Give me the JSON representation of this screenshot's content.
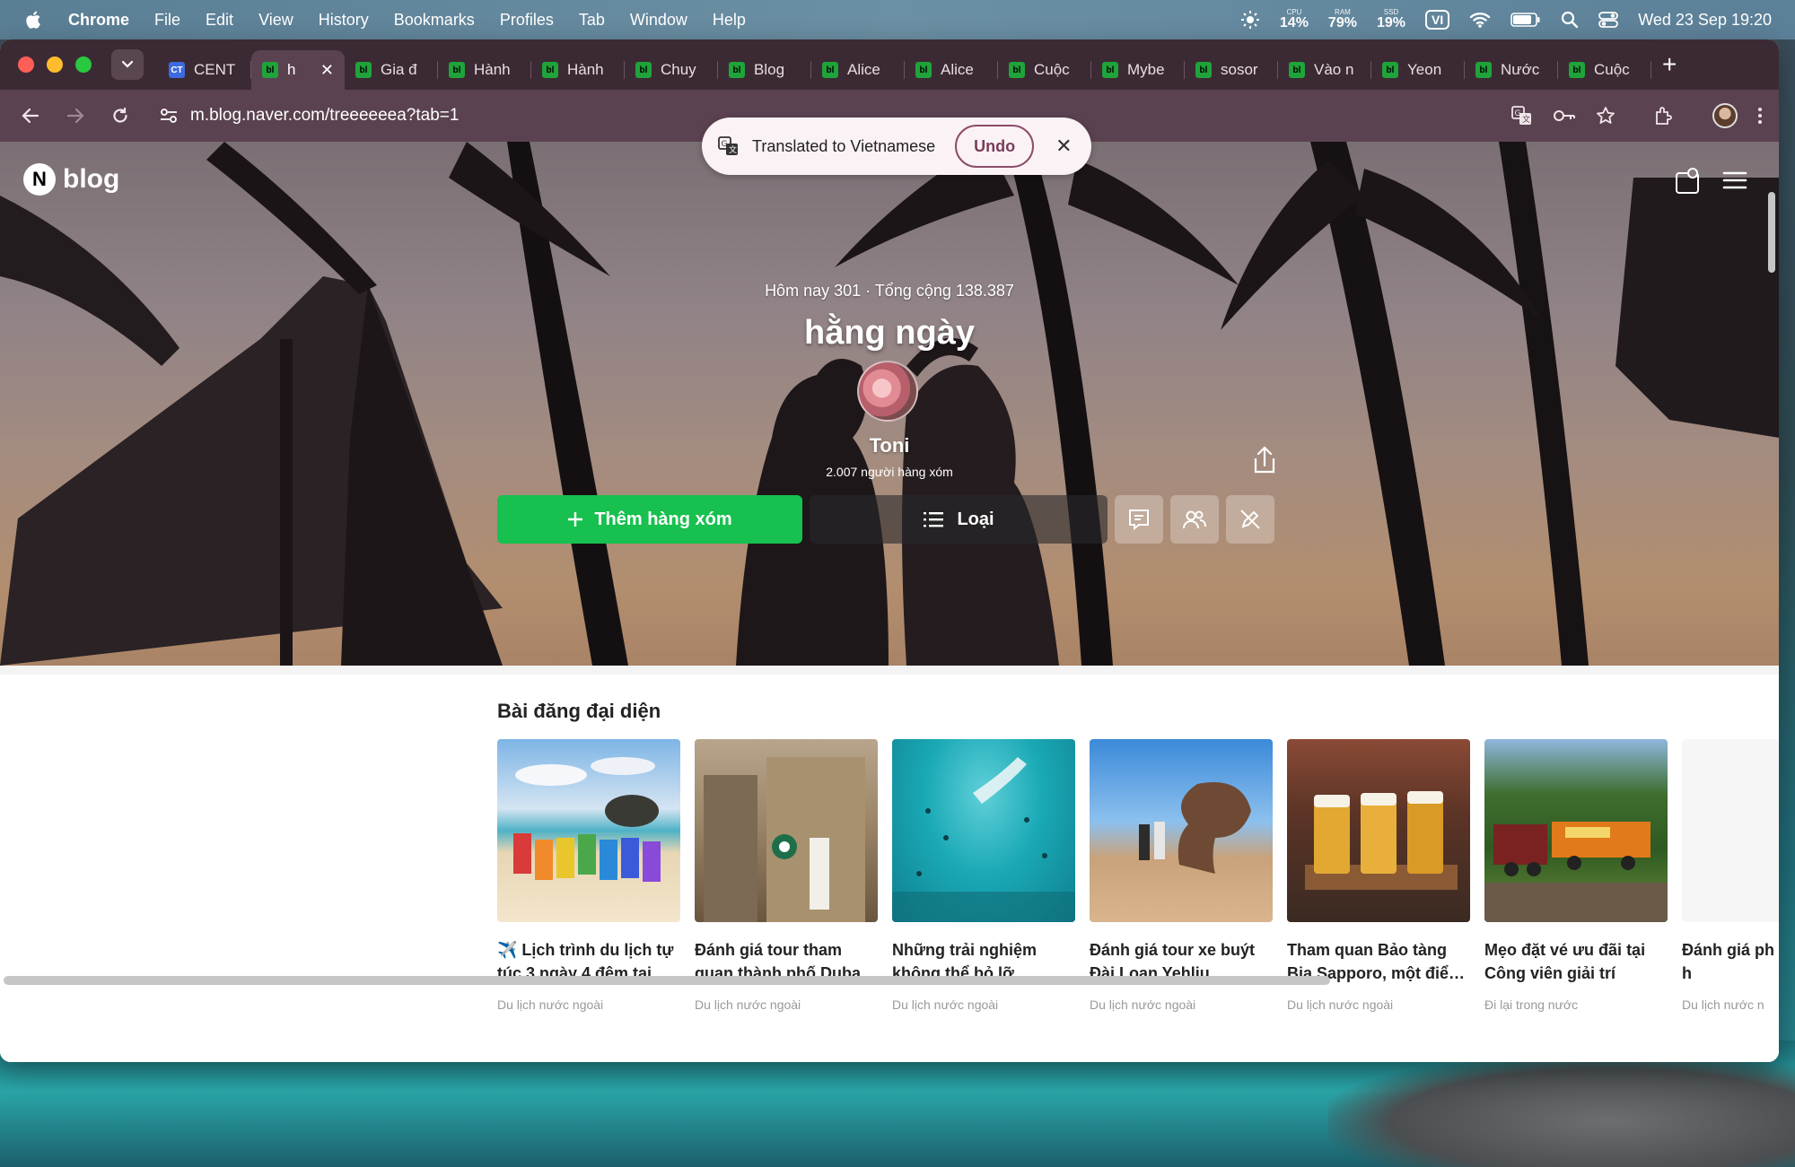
{
  "menubar": {
    "app": "Chrome",
    "items": [
      "File",
      "Edit",
      "View",
      "History",
      "Bookmarks",
      "Profiles",
      "Tab",
      "Window",
      "Help"
    ],
    "stats": [
      {
        "k": "CPU",
        "v": "14%"
      },
      {
        "k": "RAM",
        "v": "79%"
      },
      {
        "k": "SSD",
        "v": "19%"
      }
    ],
    "input_source": "VI",
    "datetime": "Wed 23 Sep  19:20"
  },
  "tabs": [
    {
      "label": "CENT",
      "favicon": "CT",
      "active": false
    },
    {
      "label": "h",
      "favicon": "bl",
      "active": true
    },
    {
      "label": "Gia đ",
      "favicon": "bl",
      "active": false
    },
    {
      "label": "Hành",
      "favicon": "bl",
      "active": false
    },
    {
      "label": "Hành",
      "favicon": "bl",
      "active": false
    },
    {
      "label": "Chuy",
      "favicon": "bl",
      "active": false
    },
    {
      "label": "Blog",
      "favicon": "bl",
      "active": false
    },
    {
      "label": "Alice",
      "favicon": "bl",
      "active": false
    },
    {
      "label": "Alice",
      "favicon": "bl",
      "active": false
    },
    {
      "label": "Cuộc",
      "favicon": "bl",
      "active": false
    },
    {
      "label": "Mybe",
      "favicon": "bl",
      "active": false
    },
    {
      "label": "sosor",
      "favicon": "bl",
      "active": false
    },
    {
      "label": "Vào n",
      "favicon": "bl",
      "active": false
    },
    {
      "label": "Yeon",
      "favicon": "bl",
      "active": false
    },
    {
      "label": "Nước",
      "favicon": "bl",
      "active": false
    },
    {
      "label": "Cuộc",
      "favicon": "bl",
      "active": false
    }
  ],
  "toolbar": {
    "url": "m.blog.naver.com/treeeeeea?tab=1"
  },
  "translate_popup": {
    "text": "Translated to Vietnamese",
    "undo": "Undo"
  },
  "blog": {
    "brand": "blog",
    "stats": "Hôm nay 301 · Tổng cộng 138.387",
    "title": "hằng ngày",
    "name": "Toni",
    "neighbors": "2.007 người hàng xóm",
    "add_neighbor": "Thêm hàng xóm",
    "category": "Loại"
  },
  "posts": {
    "heading": "Bài đăng đại diện",
    "items": [
      {
        "title": "✈️ Lịch trình du lịch tự túc 3 ngày 4 đêm tại…",
        "category": "Du lịch nước ngoài"
      },
      {
        "title": "Đánh giá tour tham quan thành phố Duba…",
        "category": "Du lịch nước ngoài"
      },
      {
        "title": "Những trải nghiệm không thể bỏ lỡ trong…",
        "category": "Du lịch nước ngoài"
      },
      {
        "title": "Đánh giá tour xe buýt Đài Loan Yehliu, Shife…",
        "category": "Du lịch nước ngoài"
      },
      {
        "title": "Tham quan Bảo tàng Bia Sapporo, một điể…",
        "category": "Du lịch nước ngoài"
      },
      {
        "title": "Mẹo đặt vé ưu đãi tại Công viên giải trí Jeju…",
        "category": "Đi lại trong nước"
      },
      {
        "title": "Đánh giá ph Twin View h",
        "category": "Du lịch nước n"
      }
    ]
  }
}
